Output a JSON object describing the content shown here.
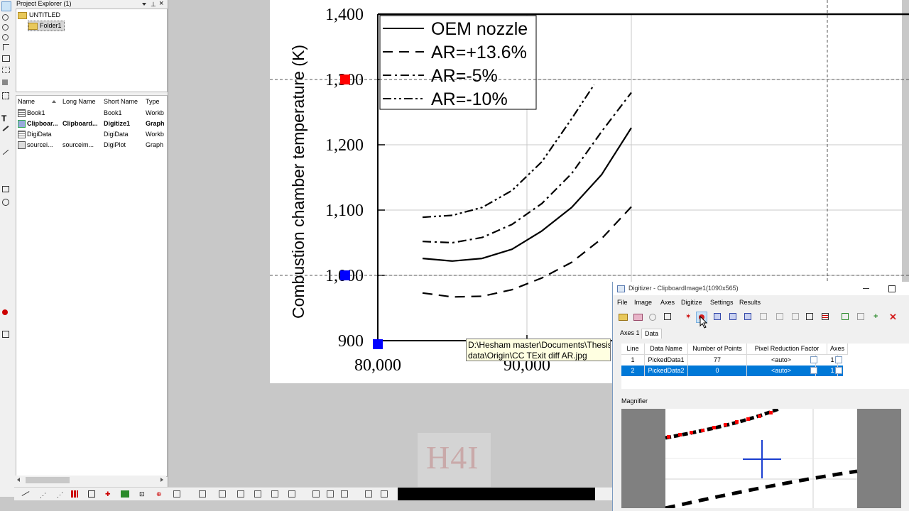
{
  "project_explorer": {
    "title": "Project Explorer (1)",
    "tree": [
      {
        "label": "UNTITLED",
        "type": "root"
      },
      {
        "label": "Folder1",
        "type": "folder",
        "selected": true
      }
    ],
    "columns": [
      "Name",
      "Long Name",
      "Short Name",
      "Type"
    ],
    "rows": [
      {
        "name": "Book1",
        "long_name": "",
        "short_name": "Book1",
        "type": "Workb",
        "icon": "workbook-icon",
        "bold": false
      },
      {
        "name": "Clipboar...",
        "long_name": "Clipboard...",
        "short_name": "Digitize1",
        "type": "Graph",
        "icon": "image-icon",
        "bold": true
      },
      {
        "name": "DigiData",
        "long_name": "",
        "short_name": "DigiData",
        "type": "Workb",
        "icon": "workbook-icon",
        "bold": false
      },
      {
        "name": "sourcei...",
        "long_name": "sourceim...",
        "short_name": "DigiPlot",
        "type": "Graph",
        "icon": "plot-icon",
        "bold": false
      }
    ]
  },
  "chart_data": {
    "type": "line",
    "title": "",
    "xlabel": "",
    "ylabel": "Combustion chamber temperature (K)",
    "y_ticks": [
      "900",
      "1,000",
      "1,100",
      "1,200",
      "1,300",
      "1,400"
    ],
    "x_ticks": [
      "80,000",
      "90,000"
    ],
    "ylim": [
      900,
      1400
    ],
    "xlim": [
      80000,
      97000
    ],
    "legend": {
      "position": "top-left",
      "entries": [
        "OEM nozzle",
        "AR=+13.6%",
        "AR=-5%",
        "AR=-10%"
      ]
    },
    "series": [
      {
        "name": "OEM nozzle",
        "style": "solid",
        "x": [
          83000,
          85000,
          87000,
          89000,
          91000,
          93000,
          95000,
          97000
        ],
        "y": [
          1026,
          1022,
          1026,
          1040,
          1068,
          1104,
          1154,
          1226
        ]
      },
      {
        "name": "AR=+13.6%",
        "style": "dashed",
        "x": [
          83000,
          85000,
          87000,
          89000,
          91000,
          93000,
          95000,
          97000
        ],
        "y": [
          973,
          967,
          968,
          978,
          996,
          1020,
          1056,
          1105
        ]
      },
      {
        "name": "AR=-5%",
        "style": "dashdot",
        "x": [
          83000,
          85000,
          87000,
          89000,
          91000,
          93000,
          95000,
          97000
        ],
        "y": [
          1052,
          1050,
          1058,
          1078,
          1110,
          1156,
          1220,
          1280
        ]
      },
      {
        "name": "AR=-10%",
        "style": "dashdotdot",
        "x": [
          83000,
          85000,
          87000,
          89000,
          91000,
          93000,
          94500
        ],
        "y": [
          1089,
          1092,
          1104,
          1130,
          1174,
          1240,
          1292
        ]
      }
    ],
    "calibration_markers": [
      {
        "axis": "y",
        "value": 1300,
        "color": "#ff0000"
      },
      {
        "axis": "y",
        "value": 1000,
        "color": "#0000ff"
      },
      {
        "axis": "x",
        "value": 80000,
        "color": "#0000ff"
      }
    ]
  },
  "tooltip": {
    "line1": "D:\\Hesham master\\Documents\\Thesis\\",
    "line2": "data\\Origin\\CC TExit diff AR.jpg"
  },
  "digitizer": {
    "title": "Digitizer - ClipboardImage1(1090x565)",
    "menu": [
      "File",
      "Image",
      "Axes",
      "Digitize",
      "Settings",
      "Results"
    ],
    "tabs": [
      "Axes 1",
      "Data"
    ],
    "active_tab": "Data",
    "table_columns": [
      "Line",
      "Data Name",
      "Number of Points",
      "Pixel Reduction Factor",
      "Axes"
    ],
    "table_rows": [
      {
        "line": "1",
        "data_name": "PickedData1",
        "points": "77",
        "reduction": "<auto>",
        "axes": "1",
        "selected": false
      },
      {
        "line": "2",
        "data_name": "PickedData2",
        "points": "0",
        "reduction": "<auto>",
        "axes": "1",
        "selected": true
      }
    ],
    "magnifier_label": "Magnifier"
  },
  "watermark": "H4I",
  "colors": {
    "selection": "#0078d7",
    "calib_red": "#ff0000",
    "calib_blue": "#0000ff",
    "crosshair": "#1b3fd1"
  }
}
